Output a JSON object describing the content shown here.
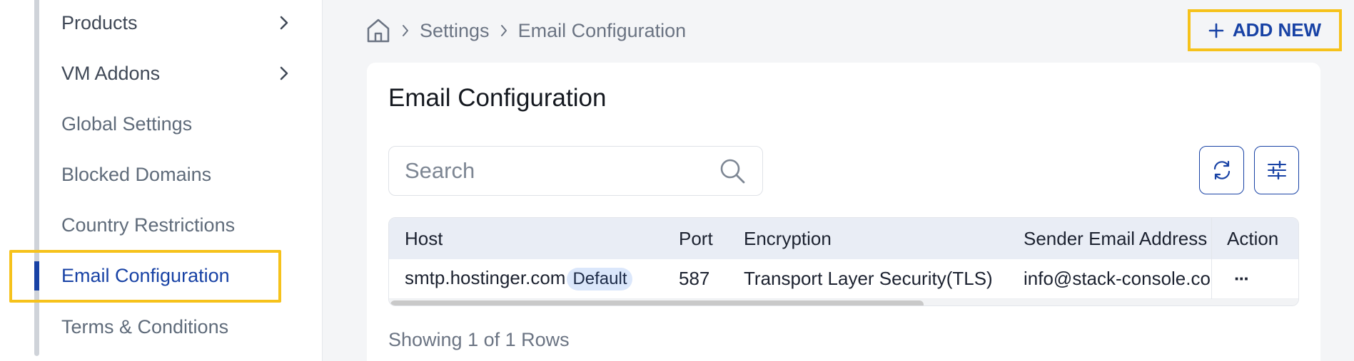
{
  "sidebar": {
    "items": [
      {
        "label": "Products",
        "has_chevron": true
      },
      {
        "label": "VM Addons",
        "has_chevron": true
      },
      {
        "label": "Global Settings",
        "has_chevron": false
      },
      {
        "label": "Blocked Domains",
        "has_chevron": false
      },
      {
        "label": "Country Restrictions",
        "has_chevron": false
      },
      {
        "label": "Email Configuration",
        "has_chevron": false,
        "active": true
      },
      {
        "label": "Terms & Conditions",
        "has_chevron": false
      }
    ]
  },
  "breadcrumb": {
    "home_icon": "home-icon",
    "items": [
      "Settings",
      "Email Configuration"
    ]
  },
  "header": {
    "add_new_label": "ADD NEW"
  },
  "card": {
    "title": "Email Configuration",
    "search": {
      "placeholder": "Search",
      "value": ""
    },
    "table": {
      "columns": [
        "Host",
        "Port",
        "Encryption",
        "Sender Email Address",
        "Action"
      ],
      "rows": [
        {
          "host": "smtp.hostinger.com",
          "badge": "Default",
          "port": "587",
          "encryption": "Transport Layer Security(TLS)",
          "sender": "info@stack-console.com",
          "action": "···"
        }
      ]
    },
    "footer": "Showing 1 of 1 Rows"
  },
  "colors": {
    "accent": "#1842a5",
    "highlight": "#f6c21b",
    "header_bg": "#e9edf5",
    "badge_bg": "#dbe7fb"
  }
}
